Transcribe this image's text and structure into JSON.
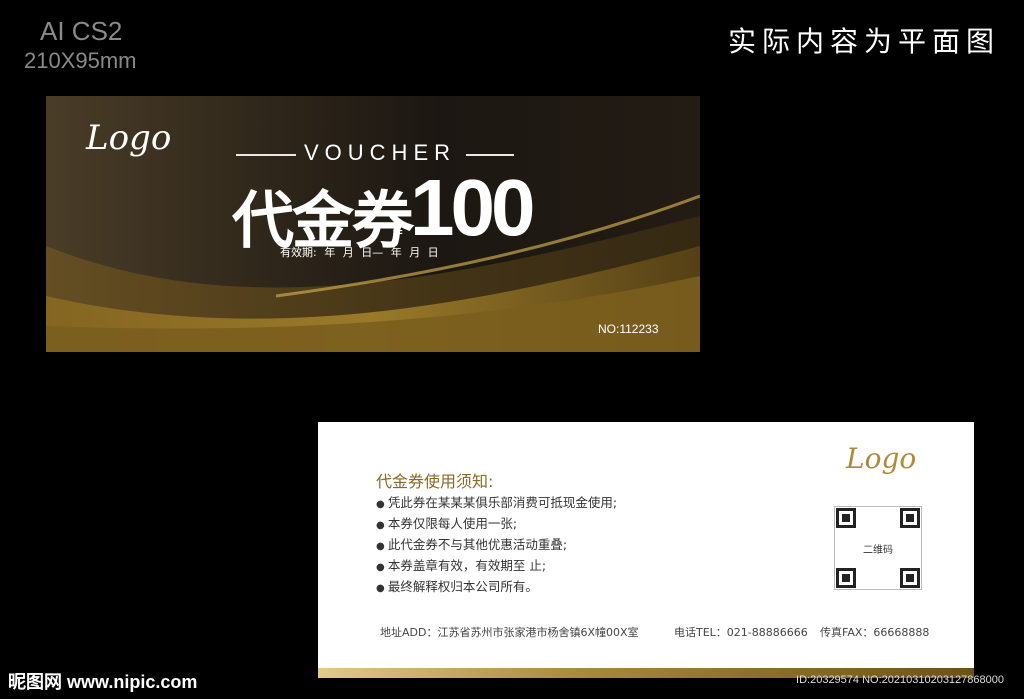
{
  "meta": {
    "format_label": "AI CS2",
    "size_label": "210X95mm",
    "flat_note": "实际内容为平面图"
  },
  "front": {
    "logo": "Logo",
    "voucher_label": "VOUCHER",
    "headline": "代金券",
    "currency_symbol": "¥",
    "amount": "100",
    "validity": "有效期:   年  月  日—  年  月  日",
    "serial": "NO:112233"
  },
  "back": {
    "logo": "Logo",
    "notice_title": "代金券使用须知:",
    "rules": [
      "凭此券在某某某俱乐部消费可抵现金使用;",
      "本券仅限每人使用一张;",
      "此代金券不与其他优惠活动重叠;",
      "本券盖章有效，有效期至          止;",
      "最终解释权归本公司所有。"
    ],
    "qr_label": "二维码",
    "address": "地址ADD：江苏省苏州市张家港市杨舍镇6X幢00X室",
    "tel": "电话TEL：021-88886666",
    "fax": "传真FAX：66668888"
  },
  "watermark": {
    "site": "昵图网 www.nipic.com",
    "id": "ID:20329574 NO:20210310203127868000"
  },
  "colors": {
    "gold": "#b08a3a",
    "dark_brown": "#2e261a"
  }
}
